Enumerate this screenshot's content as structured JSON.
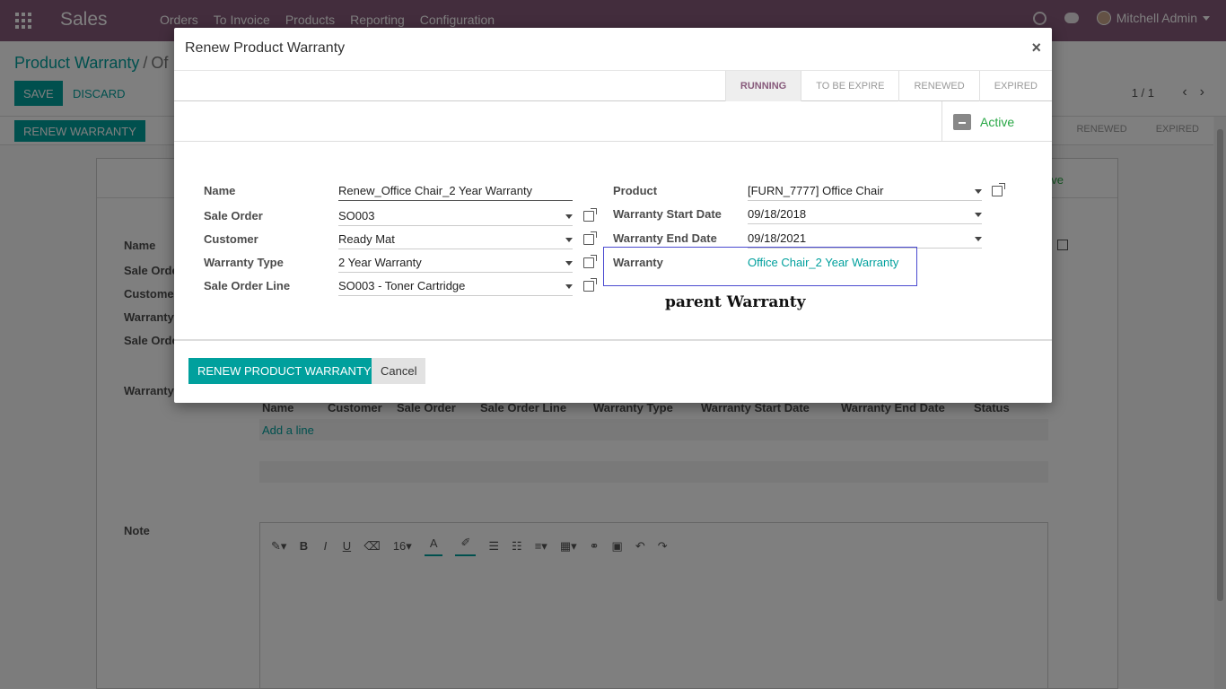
{
  "navbar": {
    "app_name": "Sales",
    "menu": [
      "Orders",
      "To Invoice",
      "Products",
      "Reporting",
      "Configuration"
    ],
    "user": "Mitchell Admin",
    "icons": [
      "apps-grid-icon",
      "clock-icon",
      "chat-icon",
      "avatar"
    ]
  },
  "control_panel": {
    "breadcrumb_parent": "Product Warranty",
    "breadcrumb_sep": "/",
    "breadcrumb_current": "Of",
    "save_label": "SAVE",
    "discard_label": "DISCARD",
    "pager": "1 / 1"
  },
  "background_form": {
    "renew_button": "RENEW WARRANTY",
    "states": [
      "RENEWED",
      "EXPIRED"
    ],
    "partial_state": "E",
    "partial_active": "ve",
    "labels": [
      "Name",
      "Sale Orde",
      "Custome",
      "Warranty",
      "Sale Orde",
      "Warranty"
    ],
    "table_headers": [
      "Name",
      "Customer",
      "Sale Order",
      "Sale Order Line",
      "Warranty Type",
      "Warranty Start Date",
      "Warranty End Date",
      "Status"
    ],
    "add_line": "Add a line",
    "note_label": "Note",
    "editor_toolbar": {
      "font_size": "16",
      "bold": "B",
      "italic": "I",
      "underline": "U",
      "color": "A"
    }
  },
  "modal": {
    "title": "Renew Product Warranty",
    "close": "×",
    "states": [
      {
        "label": "RUNNING",
        "active": true
      },
      {
        "label": "TO BE EXPIRE",
        "active": false
      },
      {
        "label": "RENEWED",
        "active": false
      },
      {
        "label": "EXPIRED",
        "active": false
      }
    ],
    "active_button": "Active",
    "fields": {
      "name": {
        "label": "Name",
        "value": "Renew_Office Chair_2 Year Warranty"
      },
      "sale_order": {
        "label": "Sale Order",
        "value": "SO003"
      },
      "customer": {
        "label": "Customer",
        "value": "Ready Mat"
      },
      "warranty_type": {
        "label": "Warranty Type",
        "value": "2 Year Warranty"
      },
      "sale_order_line": {
        "label": "Sale Order Line",
        "value": "SO003 - Toner Cartridge"
      },
      "product": {
        "label": "Product",
        "value": "[FURN_7777] Office Chair"
      },
      "start_date": {
        "label": "Warranty Start Date",
        "value": "09/18/2018"
      },
      "end_date": {
        "label": "Warranty End Date",
        "value": "09/18/2021"
      },
      "warranty": {
        "label": "Warranty",
        "value": "Office Chair_2 Year Warranty"
      }
    },
    "annotation": "parent Warranty",
    "primary_button": "RENEW PRODUCT WARRANTY",
    "cancel_button": "Cancel"
  }
}
